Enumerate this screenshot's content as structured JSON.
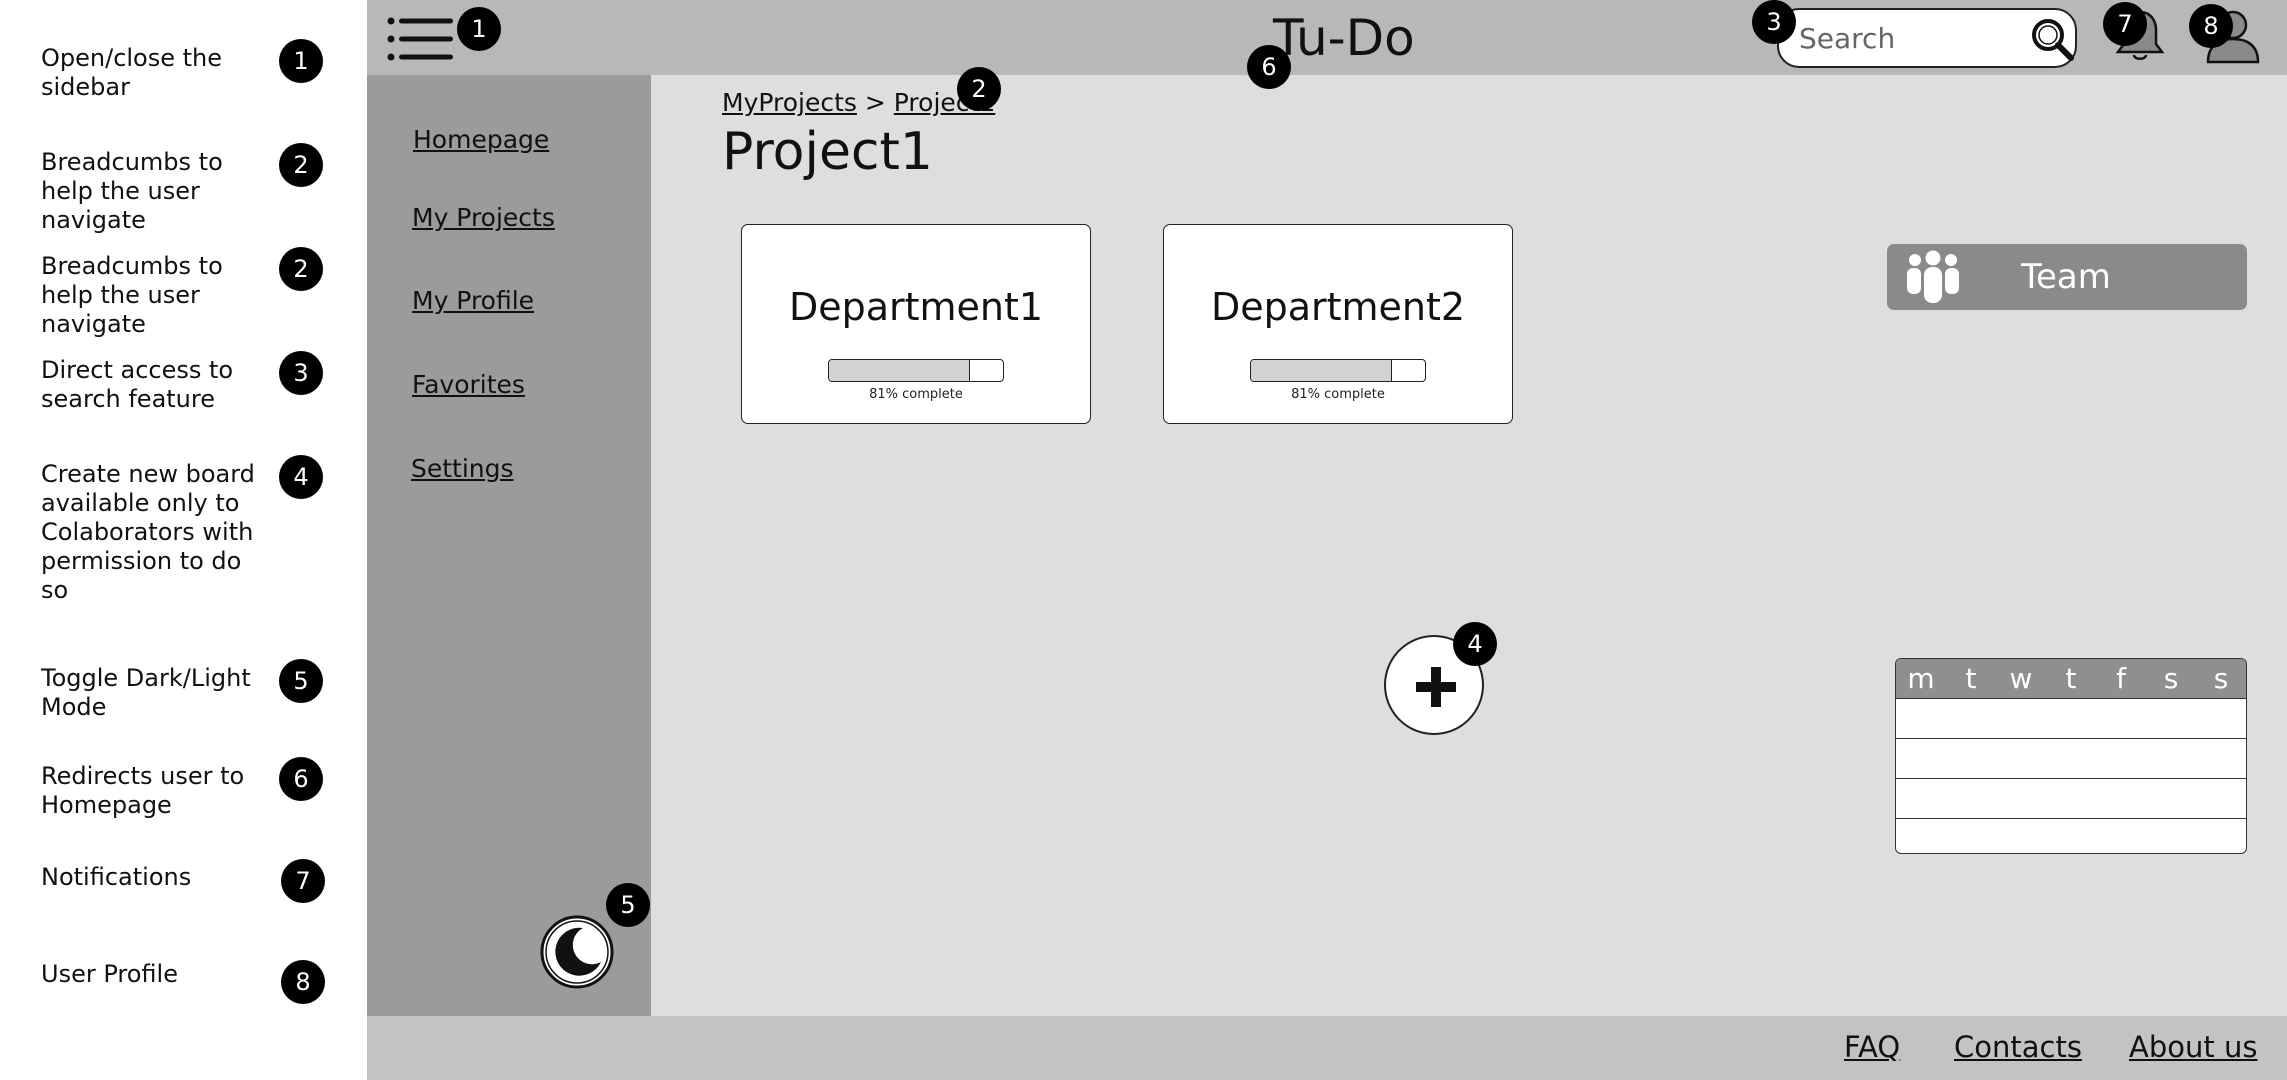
{
  "legend": [
    {
      "num": "1",
      "text": "Open/close the sidebar"
    },
    {
      "num": "2",
      "text": "Breadcumbs to help the user navigate"
    },
    {
      "num": "2",
      "text": "Breadcumbs to help the user navigate"
    },
    {
      "num": "3",
      "text": "Direct access to search feature"
    },
    {
      "num": "4",
      "text": "Create new board available only to Colaborators with permission to do so"
    },
    {
      "num": "5",
      "text": "Toggle Dark/Light Mode"
    },
    {
      "num": "6",
      "text": "Redirects user to Homepage"
    },
    {
      "num": "7",
      "text": "Notifications"
    },
    {
      "num": "8",
      "text": "User Profile"
    }
  ],
  "header": {
    "title": "Tu-Do",
    "search_placeholder": "Search",
    "menu_icon": "hamburger-icon",
    "search_icon": "magnifier-icon",
    "notification_icon": "bell-icon",
    "profile_icon": "user-icon"
  },
  "sidebar": {
    "items": [
      {
        "label": "Homepage"
      },
      {
        "label": "My Projects"
      },
      {
        "label": "My Profile"
      },
      {
        "label": "Favorites"
      },
      {
        "label": "Settings"
      }
    ],
    "theme_toggle_icon": "moon-icon"
  },
  "breadcrumb": {
    "items": [
      "MyProjects",
      "Project1"
    ],
    "separator": ">"
  },
  "page": {
    "title": "Project1"
  },
  "departments": [
    {
      "name": "Department1",
      "progress": 0.81,
      "progress_label": "81% complete"
    },
    {
      "name": "Department2",
      "progress": 0.81,
      "progress_label": "81% complete"
    }
  ],
  "team": {
    "label": "Team",
    "icon": "group-icon"
  },
  "add_board": {
    "icon": "plus-icon"
  },
  "calendar": {
    "days": [
      "m",
      "t",
      "w",
      "t",
      "f",
      "s",
      "s"
    ],
    "rows": 4
  },
  "footer": {
    "links": [
      "FAQ",
      "Contacts",
      "About us"
    ]
  },
  "markers": {
    "menu": "1",
    "breadcrumb": "2",
    "search": "3",
    "add": "4",
    "theme": "5",
    "title": "6",
    "notifications": "7",
    "profile": "8"
  },
  "colors": {
    "topbar": "#b8b8b8",
    "sidebar": "#9b9b9b",
    "content": "#dedede",
    "footer": "#c3c3c3",
    "team_button": "#8a8a8a",
    "marker": "#000000"
  }
}
